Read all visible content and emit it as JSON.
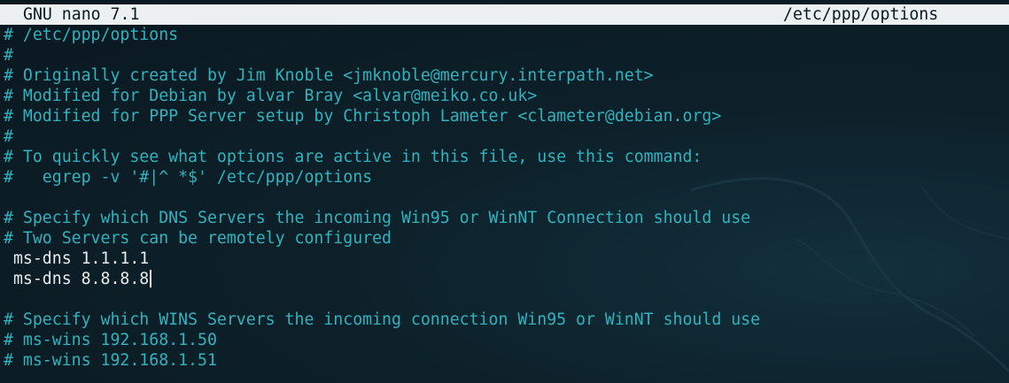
{
  "titlebar": {
    "app_name": "GNU nano 7.1",
    "file_name": "/etc/ppp/options"
  },
  "buffer": {
    "lines": [
      {
        "text": "# /etc/ppp/options",
        "kind": "comment"
      },
      {
        "text": "#",
        "kind": "comment"
      },
      {
        "text": "# Originally created by Jim Knoble <jmknoble@mercury.interpath.net>",
        "kind": "comment"
      },
      {
        "text": "# Modified for Debian by alvar Bray <alvar@meiko.co.uk>",
        "kind": "comment"
      },
      {
        "text": "# Modified for PPP Server setup by Christoph Lameter <clameter@debian.org>",
        "kind": "comment"
      },
      {
        "text": "#",
        "kind": "comment"
      },
      {
        "text": "# To quickly see what options are active in this file, use this command:",
        "kind": "comment"
      },
      {
        "text": "#   egrep -v '#|^ *$' /etc/ppp/options",
        "kind": "comment"
      },
      {
        "text": "",
        "kind": "blank"
      },
      {
        "text": "# Specify which DNS Servers the incoming Win95 or WinNT Connection should use",
        "kind": "comment"
      },
      {
        "text": "# Two Servers can be remotely configured",
        "kind": "comment"
      },
      {
        "text": " ms-dns 1.1.1.1",
        "kind": "plain"
      },
      {
        "text": " ms-dns 8.8.8.8",
        "kind": "plain"
      },
      {
        "text": "",
        "kind": "blank"
      },
      {
        "text": "# Specify which WINS Servers the incoming connection Win95 or WinNT should use",
        "kind": "comment"
      },
      {
        "text": "# ms-wins 192.168.1.50",
        "kind": "comment"
      },
      {
        "text": "# ms-wins 192.168.1.51",
        "kind": "comment"
      }
    ],
    "cursor_line_index": 12
  },
  "colors": {
    "background": "#0b1b24",
    "comment": "#2fb3bf",
    "text": "#e8ecec",
    "titlebar_bg": "#ecf0f1"
  }
}
